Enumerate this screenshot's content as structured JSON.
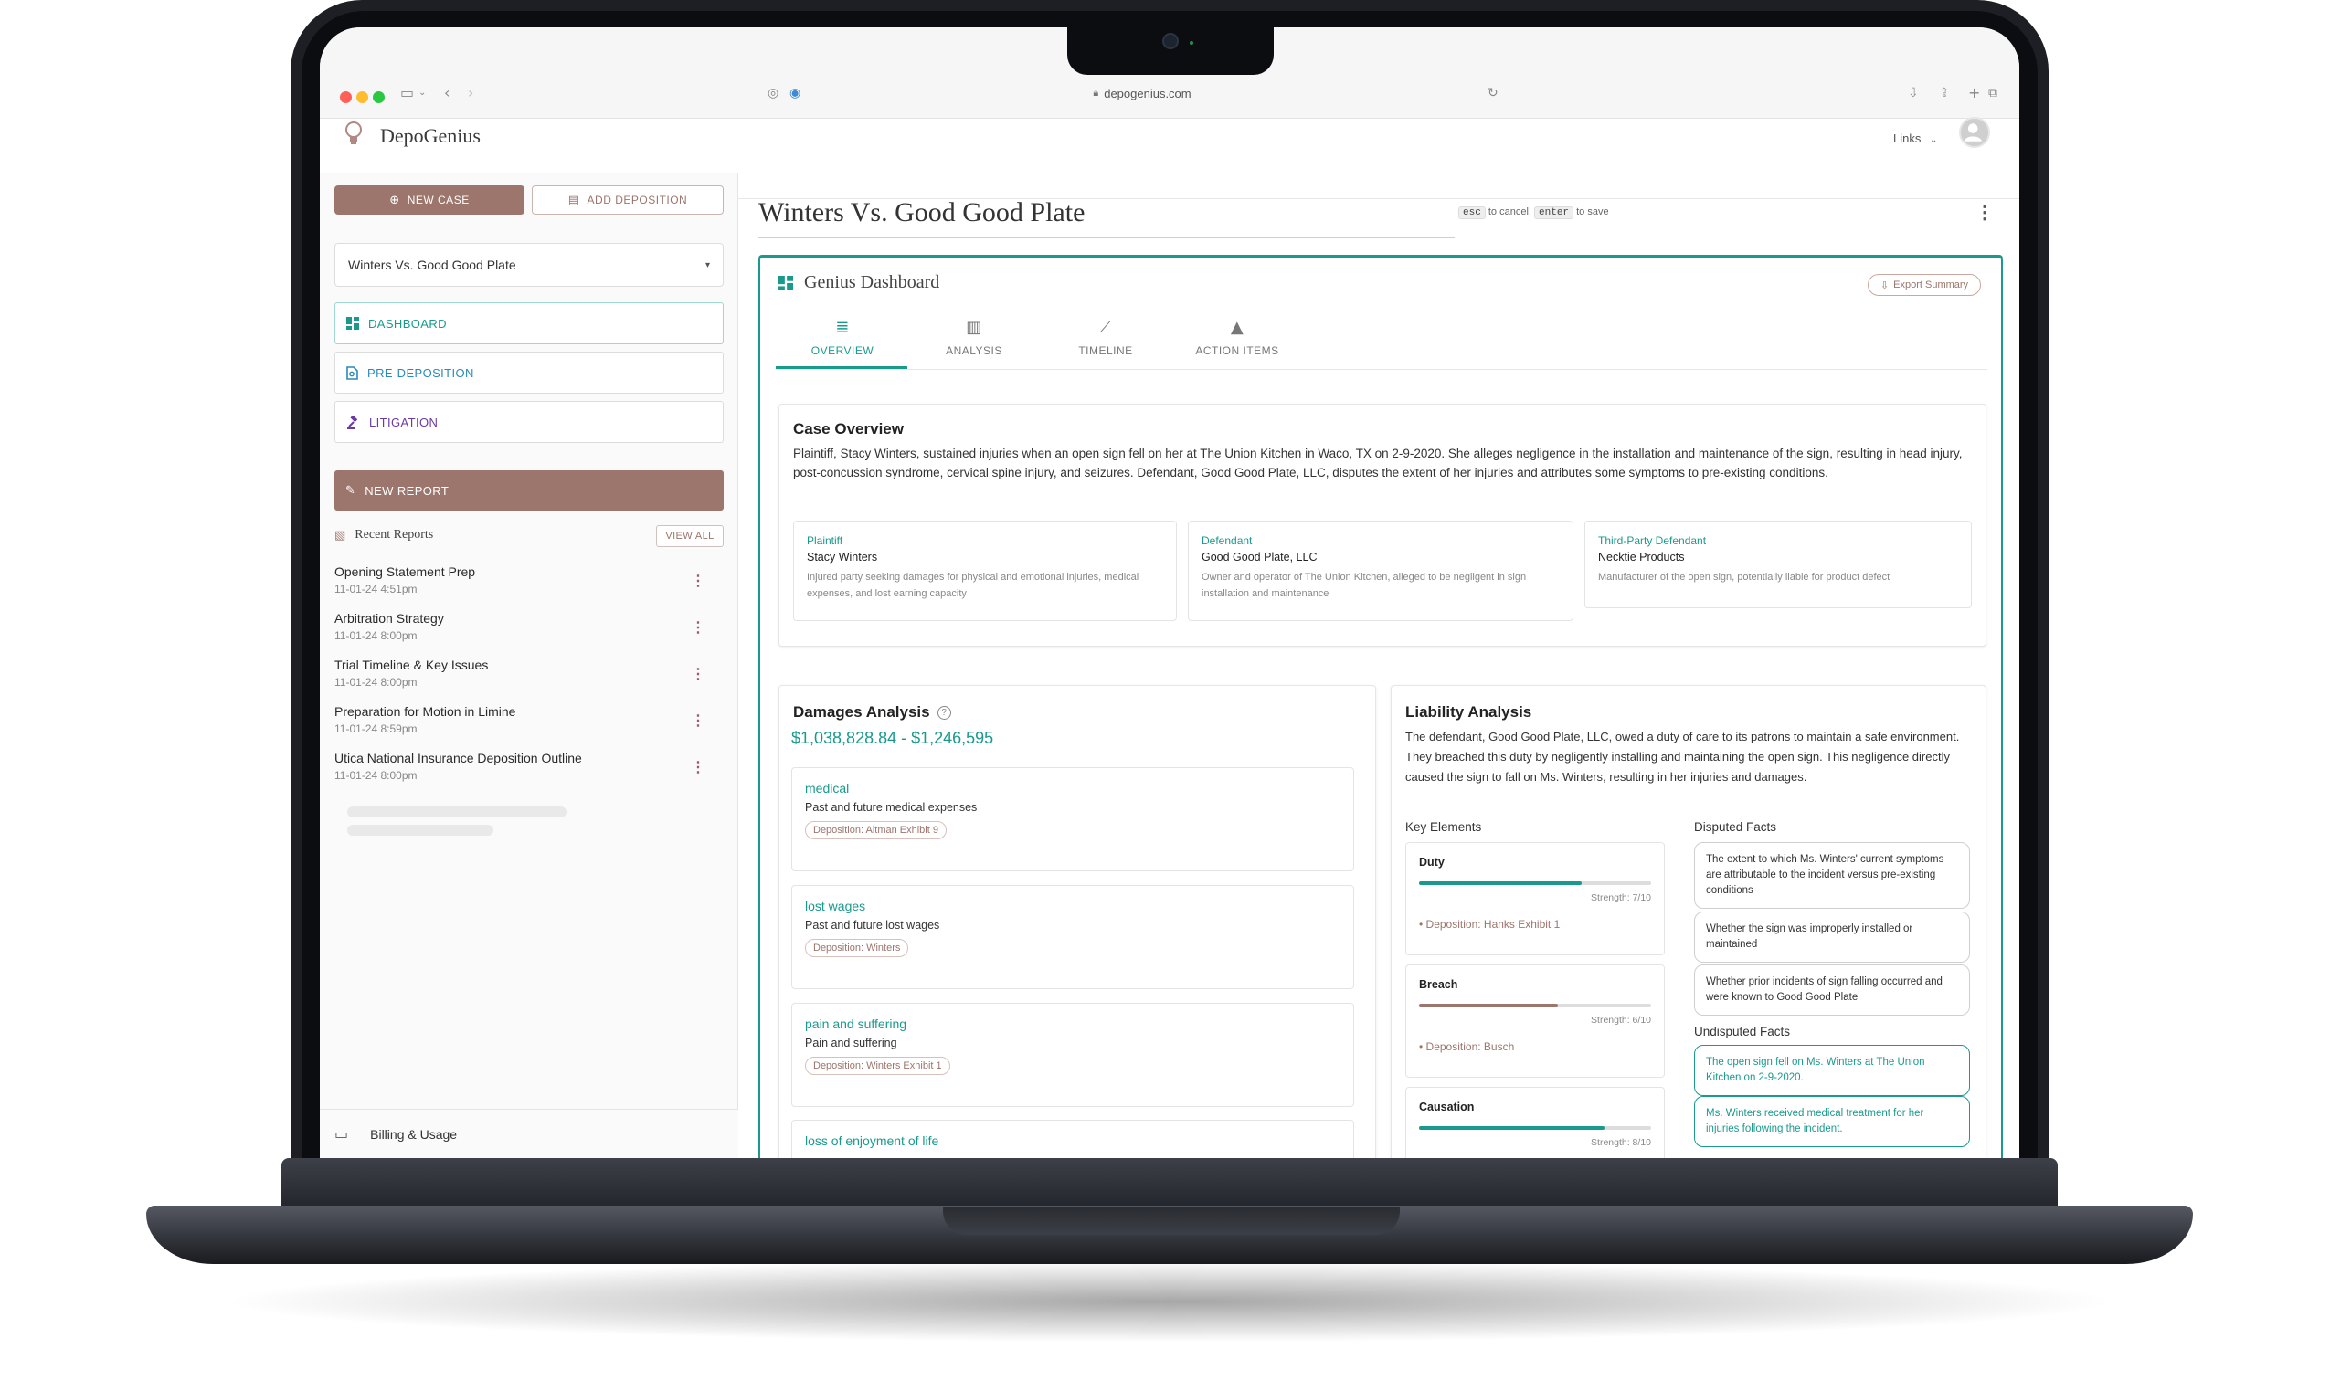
{
  "browser": {
    "url": "depogenius.com"
  },
  "app": {
    "brand": "DepoGenius",
    "links_label": "Links"
  },
  "sidebar": {
    "new_case_label": "NEW CASE",
    "add_deposition_label": "ADD DEPOSITION",
    "selected_case": "Winters Vs. Good Good Plate",
    "nav": [
      {
        "label": "DASHBOARD",
        "icon": "dashboard-icon"
      },
      {
        "label": "PRE-DEPOSITION",
        "icon": "document-search-icon"
      },
      {
        "label": "LITIGATION",
        "icon": "gavel-icon"
      }
    ],
    "new_report_label": "NEW REPORT",
    "recent_reports_title": "Recent Reports",
    "view_all_label": "VIEW ALL",
    "reports": [
      {
        "title": "Opening Statement Prep",
        "date": "11-01-24 4:51pm"
      },
      {
        "title": "Arbitration Strategy",
        "date": "11-01-24 8:00pm"
      },
      {
        "title": "Trial Timeline & Key Issues",
        "date": "11-01-24 8:00pm"
      },
      {
        "title": "Preparation for Motion in Limine",
        "date": "11-01-24 8:59pm"
      },
      {
        "title": "Utica National Insurance Deposition Outline",
        "date": "11-01-24 8:00pm"
      }
    ],
    "billing_label": "Billing & Usage"
  },
  "main": {
    "case_title": "Winters Vs. Good Good Plate",
    "hint_esc": "esc",
    "hint_cancel": "to cancel,",
    "hint_enter": "enter",
    "hint_save": "to save",
    "dashboard_title": "Genius Dashboard",
    "export_label": "Export Summary",
    "tabs": [
      {
        "label": "OVERVIEW",
        "icon": "list-icon"
      },
      {
        "label": "ANALYSIS",
        "icon": "bar-chart-icon"
      },
      {
        "label": "TIMELINE",
        "icon": "trend-line-icon"
      },
      {
        "label": "ACTION ITEMS",
        "icon": "warning-icon"
      }
    ],
    "overview": {
      "title": "Case Overview",
      "summary": "Plaintiff, Stacy Winters, sustained injuries when an open sign fell on her at The Union Kitchen in Waco, TX on 2-9-2020. She alleges negligence in the installation and maintenance of the sign, resulting in head injury, post-concussion syndrome, cervical spine injury, and seizures. Defendant, Good Good Plate, LLC, disputes the extent of her injuries and attributes some symptoms to pre-existing conditions.",
      "parties": [
        {
          "role": "Plaintiff",
          "name": "Stacy Winters",
          "desc": "Injured party seeking damages for physical and emotional injuries, medical expenses, and lost earning capacity"
        },
        {
          "role": "Defendant",
          "name": "Good Good Plate, LLC",
          "desc": "Owner and operator of The Union Kitchen, alleged to be negligent in sign installation and maintenance"
        },
        {
          "role": "Third-Party Defendant",
          "name": "Necktie Products",
          "desc": "Manufacturer of the open sign, potentially liable for product defect"
        }
      ]
    },
    "damages": {
      "title": "Damages Analysis",
      "amount": "$1,038,828.84 - $1,246,595",
      "items": [
        {
          "label": "medical",
          "desc": "Past and future medical expenses",
          "source": "Deposition: Altman Exhibit 9"
        },
        {
          "label": "lost wages",
          "desc": "Past and future lost wages",
          "source": "Deposition: Winters"
        },
        {
          "label": "pain and suffering",
          "desc": "Pain and suffering",
          "source": "Deposition: Winters Exhibit 1"
        },
        {
          "label": "loss of enjoyment of life",
          "desc": "",
          "source": ""
        }
      ]
    },
    "liability": {
      "title": "Liability Analysis",
      "summary": "The defendant, Good Good Plate, LLC, owed a duty of care to its patrons to maintain a safe environment. They breached this duty by negligently installing and maintaining the open sign. This negligence directly caused the sign to fall on Ms. Winters, resulting in her injuries and damages.",
      "key_elements_title": "Key Elements",
      "key_elements": [
        {
          "name": "Duty",
          "strength": 0.7,
          "strength_label": "Strength: 7/10",
          "source": "• Deposition: Hanks Exhibit 1",
          "color": "#1a9a8d"
        },
        {
          "name": "Breach",
          "strength": 0.6,
          "strength_label": "Strength: 6/10",
          "source": "• Deposition: Busch",
          "color": "#9c756c"
        },
        {
          "name": "Causation",
          "strength": 0.8,
          "strength_label": "Strength: 8/10",
          "source": "",
          "color": "#1a9a8d"
        }
      ],
      "disputed_title": "Disputed Facts",
      "disputed": [
        "The extent to which Ms. Winters' current symptoms are attributable to the incident versus pre-existing conditions",
        "Whether the sign was improperly installed or maintained",
        "Whether prior incidents of sign falling occurred and were known to Good Good Plate"
      ],
      "undisputed_title": "Undisputed Facts",
      "undisputed": [
        "The open sign fell on Ms. Winters at The Union Kitchen on 2-9-2020.",
        "Ms. Winters received medical treatment for her injuries following the incident."
      ]
    }
  }
}
